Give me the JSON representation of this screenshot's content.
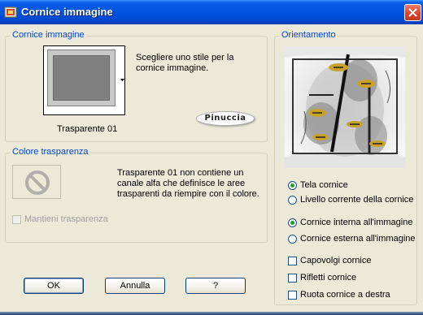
{
  "window": {
    "title": "Cornice immagine",
    "accent": "#0054e3",
    "group_label_color": "#0046d5"
  },
  "frame_group": {
    "label": "Cornice immagine",
    "style_name": "Trasparente 01",
    "description": "Scegliere uno stile per la cornice immagine.",
    "logo_text": "Pinuccia"
  },
  "transparency_group": {
    "label": "Colore trasparenza",
    "message_line1": "Trasparente 01 non contiene un",
    "message_line2": "canale alfa che definisce le aree",
    "message_line3": "trasparenti da riempire con il colore.",
    "keep_transparency_label": "Mantieni trasparenza",
    "keep_transparency_checked": false,
    "keep_transparency_enabled": false
  },
  "orientation_group": {
    "label": "Orientamento",
    "apply_to": {
      "options": [
        "Tela cornice",
        "Livello corrente della cornice"
      ],
      "selected": "Tela cornice"
    },
    "position": {
      "options": [
        "Cornice interna all'immagine",
        "Cornice esterna all'immagine"
      ],
      "selected": "Cornice interna all'immagine"
    },
    "checkboxes": [
      {
        "label": "Capovolgi cornice",
        "checked": false
      },
      {
        "label": "Rifletti cornice",
        "checked": false
      },
      {
        "label": "Ruota cornice a destra",
        "checked": false
      }
    ]
  },
  "buttons": {
    "ok": "OK",
    "cancel": "Annulla",
    "help": "?"
  }
}
